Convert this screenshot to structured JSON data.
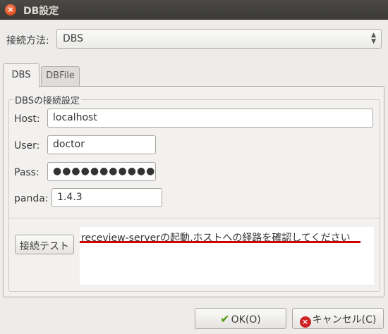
{
  "window": {
    "title": "DB設定",
    "close_glyph": "×"
  },
  "connection": {
    "label": "接続方法:",
    "value": "DBS",
    "arrow_up": "▲",
    "arrow_down": "▼"
  },
  "tabs": [
    {
      "label": "DBS",
      "active": true
    },
    {
      "label": "DBFile",
      "active": false
    }
  ],
  "dbs": {
    "group_label": "DBSの接続設定",
    "host": {
      "label": "Host:",
      "value": "localhost"
    },
    "user": {
      "label": "User:",
      "value": "doctor"
    },
    "pass": {
      "label": "Pass:",
      "masked": "●●●●●●●●●●●"
    },
    "panda": {
      "label": "panda:",
      "value": "1.4.3"
    },
    "test_button": "接続テスト",
    "message": "receview-serverの起動,ホストへの経路を確認してください"
  },
  "buttons": {
    "ok": "OK(O)",
    "ok_icon": "✔",
    "cancel": "キャンセル(C)",
    "cancel_icon": "×"
  },
  "colors": {
    "underline": "#cc0000",
    "ok_icon": "#4e9a06",
    "cancel_icon": "#cc2222"
  }
}
